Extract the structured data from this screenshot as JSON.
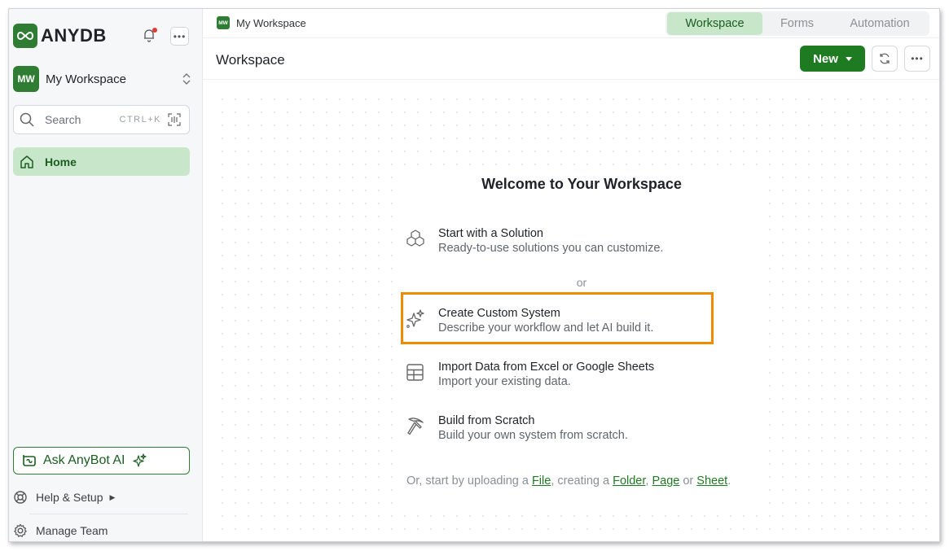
{
  "brand": {
    "name": "ANYDB",
    "accent": "#2e7d32"
  },
  "sidebar": {
    "workspace": {
      "initials": "MW",
      "name": "My Workspace"
    },
    "search": {
      "placeholder": "Search",
      "shortcut": "CTRL+K"
    },
    "nav": [
      {
        "label": "Home",
        "icon": "home-icon",
        "active": true
      }
    ],
    "ask_bot": "Ask AnyBot AI",
    "help": "Help & Setup",
    "manage_team": "Manage Team"
  },
  "topbar": {
    "breadcrumb": {
      "initials": "MW",
      "label": "My Workspace"
    },
    "tabs": [
      {
        "label": "Workspace",
        "active": true
      },
      {
        "label": "Forms"
      },
      {
        "label": "Automation"
      }
    ]
  },
  "header": {
    "title": "Workspace",
    "new_label": "New"
  },
  "main": {
    "welcome": "Welcome to Your Workspace",
    "options": [
      {
        "title": "Start with a Solution",
        "desc": "Ready-to-use solutions you can customize.",
        "icon": "cubes-icon"
      },
      {
        "title": "Create Custom System",
        "desc": "Describe your workflow and let AI build it.",
        "icon": "sparkles-icon",
        "highlight_color": "#f08a00"
      },
      {
        "title": "Import Data from Excel or Google Sheets",
        "desc": "Import your existing data.",
        "icon": "table-icon"
      },
      {
        "title": "Build from Scratch",
        "desc": "Build your own system from scratch.",
        "icon": "pickaxe-icon"
      }
    ],
    "or": "or",
    "footer": {
      "prefix": "Or, start by uploading a ",
      "file": "File",
      "mid1": ", creating a ",
      "folder": "Folder",
      "comma": ", ",
      "page": "Page",
      "or": " or ",
      "sheet": "Sheet",
      "end": "."
    }
  }
}
